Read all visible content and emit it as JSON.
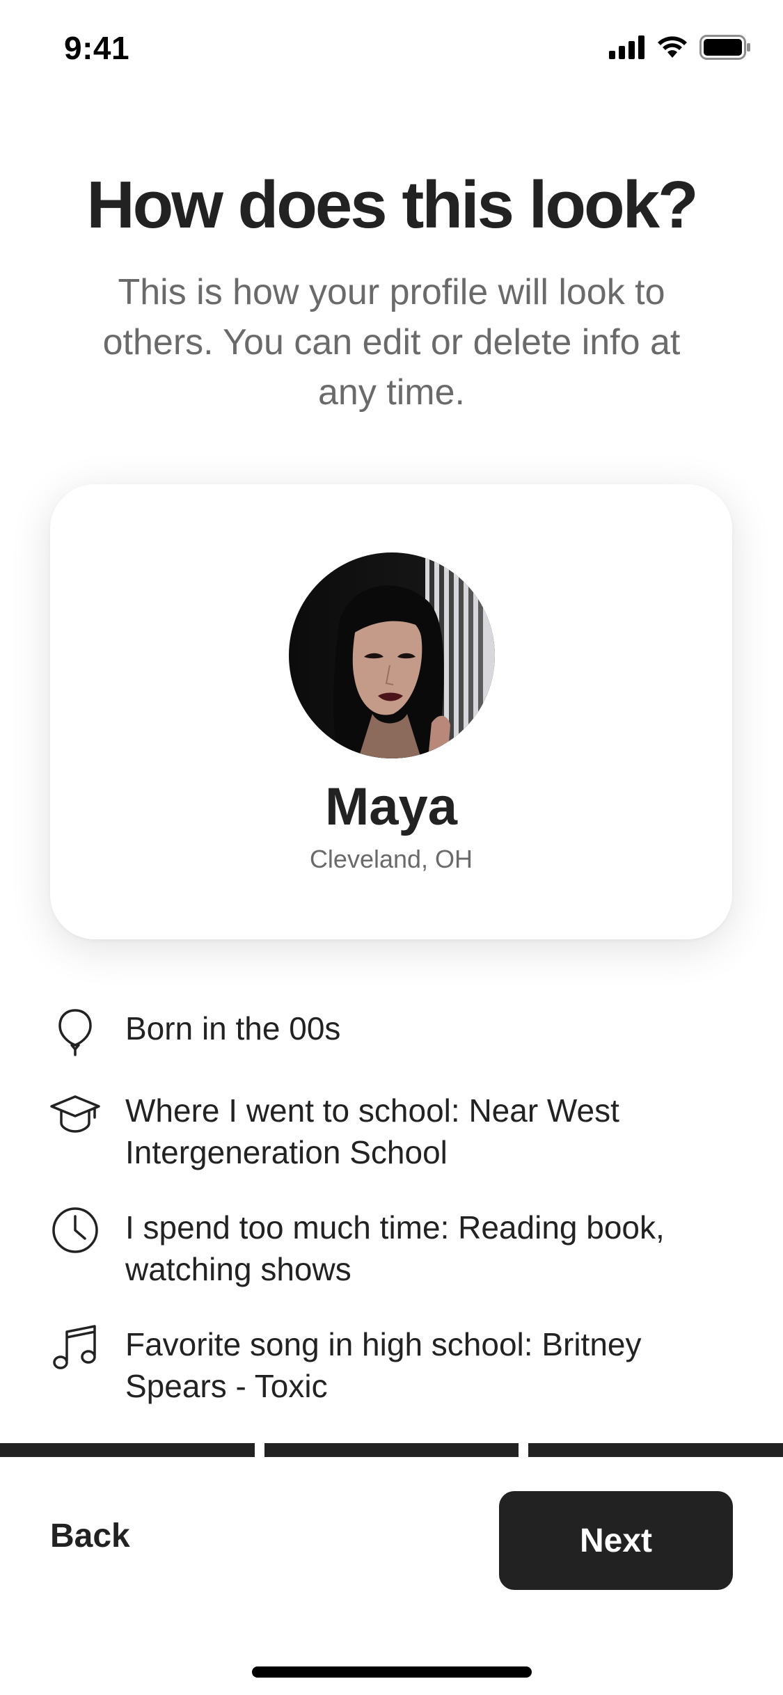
{
  "status_bar": {
    "time": "9:41",
    "icons": [
      "cellular-signal-icon",
      "wifi-icon",
      "battery-icon"
    ]
  },
  "header": {
    "title": "How does this look?",
    "subtitle": "This is how your profile will look to others. You can edit or delete info at any time."
  },
  "profile_card": {
    "name": "Maya",
    "location": "Cleveland, OH"
  },
  "facts": [
    {
      "icon": "balloon-icon",
      "text": "Born in the 00s"
    },
    {
      "icon": "graduation-cap-icon",
      "text": "Where I went to school: Near West Intergeneration School"
    },
    {
      "icon": "clock-icon",
      "text": "I spend too much time: Reading book, watching shows"
    },
    {
      "icon": "music-note-icon",
      "text": "Favorite song in high school: Britney Spears - Toxic"
    }
  ],
  "progress": {
    "segments": 3,
    "completed": 3
  },
  "footer": {
    "back_label": "Back",
    "next_label": "Next"
  },
  "colors": {
    "text": "#222222",
    "muted": "#6a6a6a",
    "button": "#222222",
    "button_text": "#ffffff"
  }
}
